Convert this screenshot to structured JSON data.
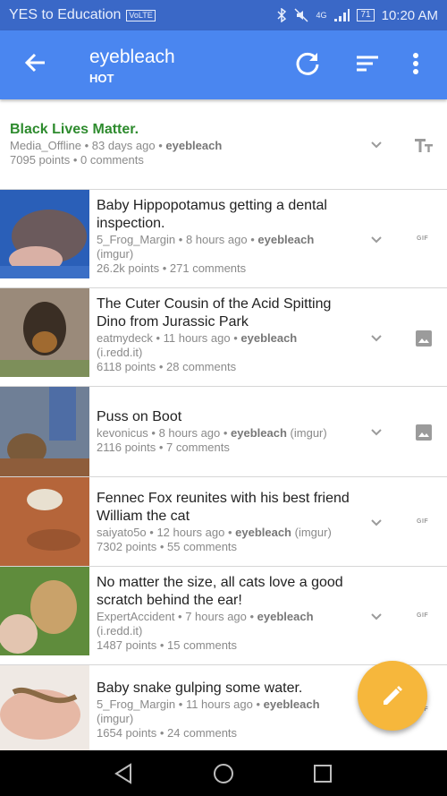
{
  "status_bar": {
    "carrier": "YES to Education",
    "volte": "VoLTE",
    "network": "4G",
    "battery": "71",
    "time": "10:20 AM"
  },
  "app_bar": {
    "title": "eyebleach",
    "subtitle": "HOT"
  },
  "posts": [
    {
      "title": "Black Lives Matter.",
      "author": "Media_Offline",
      "age": "83 days ago",
      "subreddit": "eyebleach",
      "domain": "",
      "points": "7095 points",
      "comments": "0 comments",
      "type_icon": "text-icon",
      "title_color": "#2e8b2e"
    },
    {
      "title": "Baby Hippopotamus getting a dental inspection.",
      "author": "5_Frog_Margin",
      "age": "8 hours ago",
      "subreddit": "eyebleach",
      "domain": "(imgur)",
      "points": "26.2k points",
      "comments": "271 comments",
      "type_label": "GIF"
    },
    {
      "title": "The Cuter Cousin of the Acid Spitting Dino from Jurassic Park",
      "author": "eatmydeck",
      "age": "11 hours ago",
      "subreddit": "eyebleach",
      "domain": "(i.redd.it)",
      "points": "6118 points",
      "comments": "28 comments",
      "type_icon": "image-icon"
    },
    {
      "title": "Puss on Boot",
      "author": "kevonicus",
      "age": "8 hours ago",
      "subreddit": "eyebleach",
      "domain": "(imgur)",
      "points": "2116 points",
      "comments": "7 comments",
      "type_icon": "image-icon"
    },
    {
      "title": "Fennec Fox reunites with his best friend William the cat",
      "author": "saiyato5o",
      "age": "12 hours ago",
      "subreddit": "eyebleach",
      "domain": "(imgur)",
      "points": "7302 points",
      "comments": "55 comments",
      "type_label": "GIF"
    },
    {
      "title": "No matter the size, all cats love a good scratch behind the ear!",
      "author": "ExpertAccident",
      "age": "7 hours ago",
      "subreddit": "eyebleach",
      "domain": "(i.redd.it)",
      "points": "1487 points",
      "comments": "15 comments",
      "type_label": "GIF"
    },
    {
      "title": "Baby snake gulping some water.",
      "author": "5_Frog_Margin",
      "age": "11 hours ago",
      "subreddit": "eyebleach",
      "domain": "(imgur)",
      "points": "1654 points",
      "comments": "24 comments",
      "type_label": "GIF"
    }
  ],
  "colors": {
    "app_bar": "#4a86f0",
    "status_bar": "#3a68c7",
    "fab": "#f6b73c",
    "accent_green": "#2e8b2e"
  },
  "icons": {
    "back": "arrow-left-icon",
    "refresh": "refresh-icon",
    "sort": "sort-icon",
    "menu": "more-vert-icon",
    "expand": "chevron-down-icon",
    "fab": "pencil-icon"
  }
}
